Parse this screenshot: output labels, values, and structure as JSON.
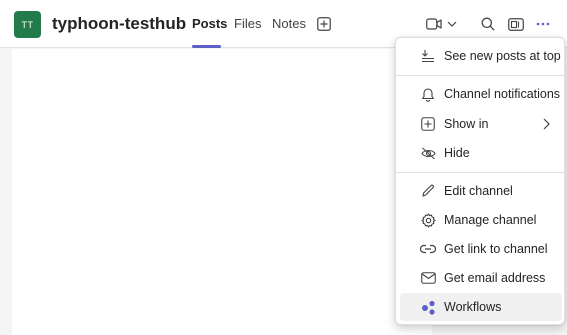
{
  "header": {
    "team_initials": "TT",
    "channel_name": "typhoon-testhub",
    "tabs": [
      {
        "label": "Posts",
        "active": true
      },
      {
        "label": "Files",
        "active": false
      },
      {
        "label": "Notes",
        "active": false
      }
    ],
    "icons": [
      "add-tab-icon",
      "video-camera-icon",
      "chevron-down-icon",
      "search-icon",
      "meeting-panel-icon",
      "more-options-icon"
    ]
  },
  "menu": {
    "items": [
      {
        "label": "See new posts at top",
        "icon": "sort-icon"
      },
      {
        "label": "Channel notifications",
        "icon": "bell-icon"
      },
      {
        "label": "Show in",
        "icon": "add-square-icon",
        "has_submenu": true
      },
      {
        "label": "Hide",
        "icon": "eye-hide-icon"
      },
      {
        "label": "Edit channel",
        "icon": "pencil-icon"
      },
      {
        "label": "Manage channel",
        "icon": "gear-icon"
      },
      {
        "label": "Get link to channel",
        "icon": "link-icon"
      },
      {
        "label": "Get email address",
        "icon": "mail-icon"
      },
      {
        "label": "Workflows",
        "icon": "workflows-icon",
        "highlighted": true
      }
    ]
  },
  "colors": {
    "brand": "#5b5fc7",
    "team_avatar": "#237b4b",
    "workflows_icon": "#5b5fc7"
  }
}
